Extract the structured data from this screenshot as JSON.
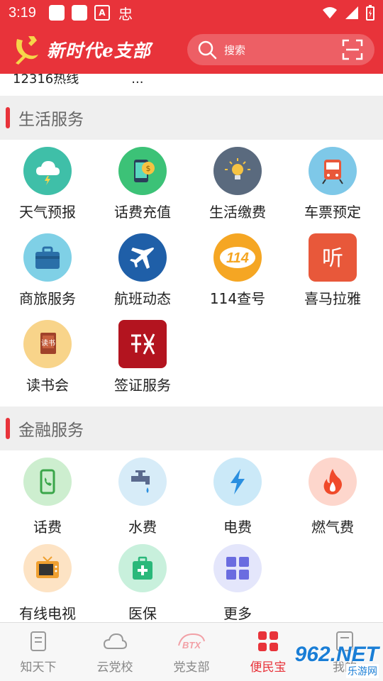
{
  "status_bar": {
    "time": "3:19",
    "a_badge": "A",
    "bug_glyph": "忠"
  },
  "header": {
    "title": "新时代e支部",
    "search_placeholder": "搜索"
  },
  "top_row": {
    "label": "12316热线",
    "more": "..."
  },
  "sections": [
    {
      "title": "生活服务",
      "items": [
        {
          "label": "天气预报",
          "icon": "weather-icon",
          "color": "#3fbfa8"
        },
        {
          "label": "话费充值",
          "icon": "phone-recharge-icon",
          "color": "#3cc277"
        },
        {
          "label": "生活缴费",
          "icon": "lightbulb-icon",
          "color": "#5a6a7e"
        },
        {
          "label": "车票预定",
          "icon": "train-icon",
          "color": "#7ec8e8"
        },
        {
          "label": "商旅服务",
          "icon": "briefcase-icon",
          "color": "#7fd0e6"
        },
        {
          "label": "航班动态",
          "icon": "airplane-icon",
          "color": "#1f5fa8"
        },
        {
          "label": "114查号",
          "icon": "114-icon",
          "color": "#f5a623"
        },
        {
          "label": "喜马拉雅",
          "icon": "ximalaya-icon",
          "color": "#e8583a"
        },
        {
          "label": "读书会",
          "icon": "book-icon",
          "color": "#f8d48a"
        },
        {
          "label": "签证服务",
          "icon": "visa-icon",
          "color": "#b3141f"
        }
      ]
    },
    {
      "title": "金融服务",
      "items": [
        {
          "label": "话费",
          "icon": "mobile-bill-icon",
          "color": "#cdeecf"
        },
        {
          "label": "水费",
          "icon": "water-tap-icon",
          "color": "#d7ecf8"
        },
        {
          "label": "电费",
          "icon": "lightning-icon",
          "color": "#cbe9f8"
        },
        {
          "label": "燃气费",
          "icon": "flame-icon",
          "color": "#fdd6cc"
        },
        {
          "label": "有线电视",
          "icon": "tv-icon",
          "color": "#fde3c4"
        },
        {
          "label": "医保",
          "icon": "medical-kit-icon",
          "color": "#c8f0dc"
        },
        {
          "label": "更多",
          "icon": "more-grid-icon",
          "color": "#e4e6fb"
        }
      ]
    }
  ],
  "tabs": [
    {
      "label": "知天下",
      "icon": "document-icon",
      "active": false
    },
    {
      "label": "云党校",
      "icon": "cloud-icon",
      "active": false
    },
    {
      "label": "党支部",
      "icon": "btx-icon",
      "active": false
    },
    {
      "label": "便民宝",
      "icon": "grid-icon",
      "active": true
    },
    {
      "label": "我的",
      "icon": "profile-icon",
      "active": false
    }
  ],
  "watermark": {
    "brand": "962.NET",
    "site": "乐游网"
  },
  "colors": {
    "accent": "#e8333a"
  }
}
